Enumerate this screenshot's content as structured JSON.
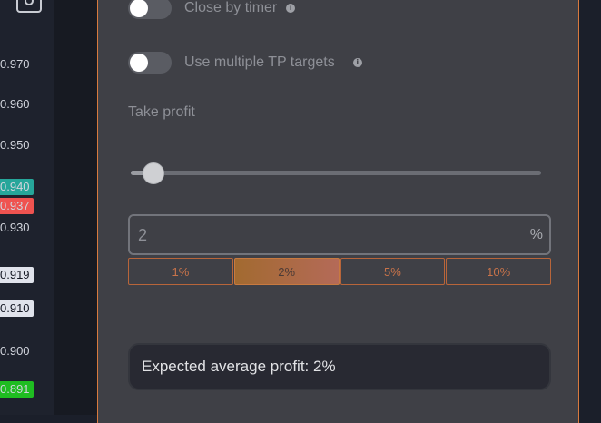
{
  "price_scale": {
    "ticks": [
      {
        "label": "0.970"
      },
      {
        "label": "0.960"
      },
      {
        "label": "0.950"
      },
      {
        "label": "0.940",
        "tag_color": "#26a69a"
      },
      {
        "label": "0.937",
        "tag_color": "#ef5350"
      },
      {
        "label": "0.930"
      },
      {
        "label": "0.919",
        "tag_color": "#e0e3eb",
        "text_color": "#131722"
      },
      {
        "label": "0.910",
        "tag_color": "#e0e3eb",
        "text_color": "#131722"
      },
      {
        "label": "0.900"
      },
      {
        "label": "0.891",
        "tag_color": "#1fbd21"
      }
    ],
    "camera_icon": "camera-icon"
  },
  "settings": {
    "close_by_timer": {
      "label": "Close by timer",
      "enabled": false
    },
    "multiple_tp": {
      "label": "Use multiple TP targets",
      "enabled": false
    },
    "take_profit": {
      "label": "Take profit",
      "slider_percent": 2,
      "slider_min": 0,
      "slider_max": 100,
      "value": "2",
      "unit": "%",
      "presets": [
        "1%",
        "2%",
        "5%",
        "10%"
      ],
      "active_preset": "2%"
    },
    "summary": "Expected average profit: 2%"
  },
  "colors": {
    "accent": "#d87a3e",
    "panel_bg": "#3f4046"
  }
}
